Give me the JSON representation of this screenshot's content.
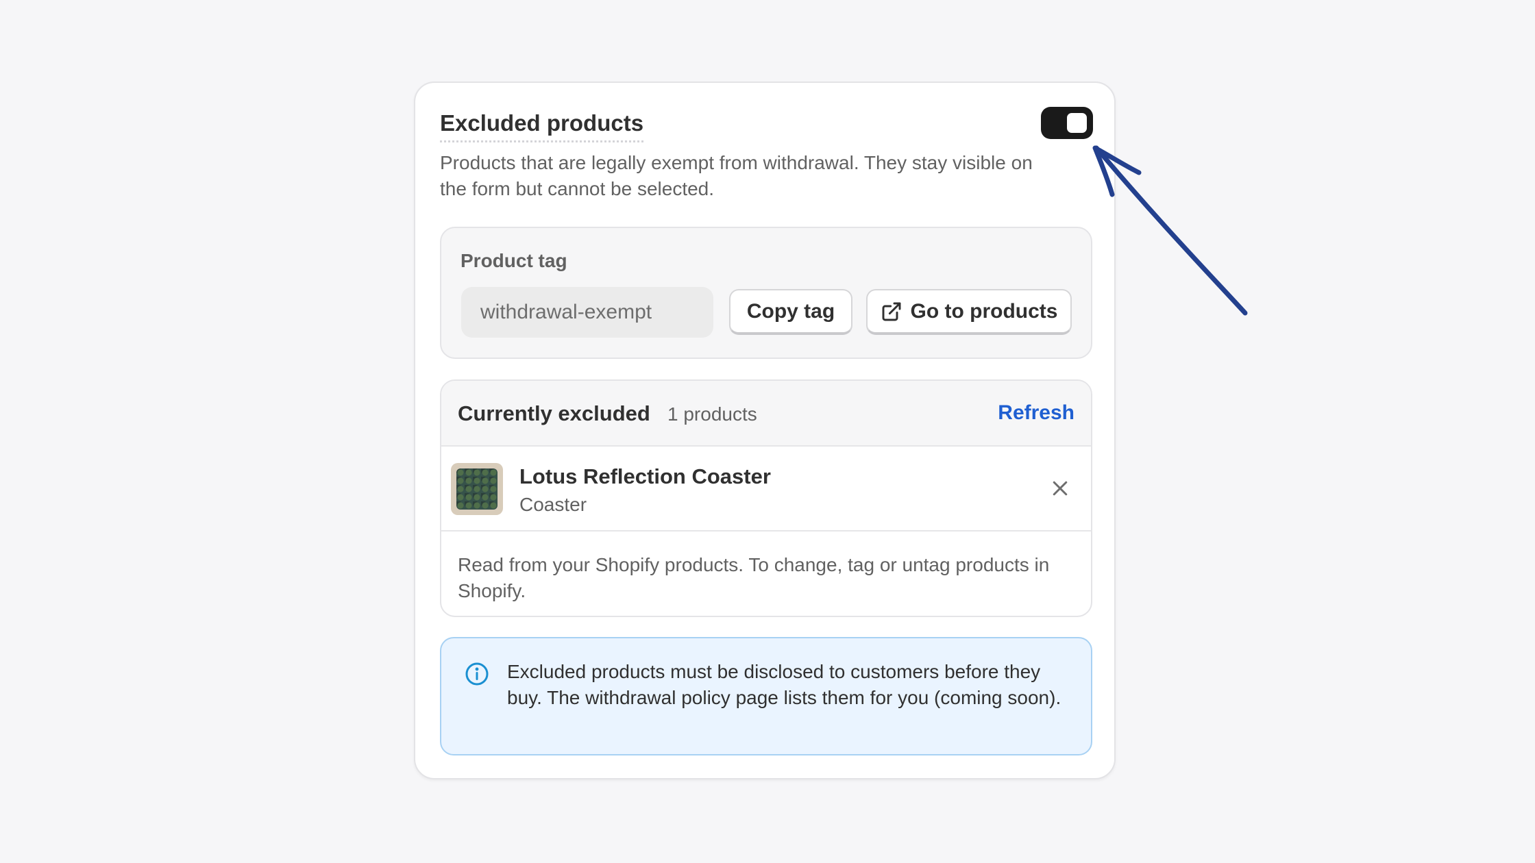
{
  "section": {
    "title": "Excluded products",
    "description": "Products that are legally exempt from withdrawal. They stay visible on the form but cannot be selected.",
    "toggle_on": true
  },
  "product_tag": {
    "label": "Product tag",
    "value": "withdrawal-exempt",
    "copy_button": "Copy tag",
    "go_button": "Go to products",
    "go_icon": "external-link-icon"
  },
  "excluded": {
    "title": "Currently excluded",
    "count": "1 products",
    "refresh": "Refresh",
    "items": [
      {
        "name": "Lotus Reflection Coaster",
        "type": "Coaster"
      }
    ],
    "note": "Read from your Shopify products. To change, tag or untag products in Shopify."
  },
  "banner": {
    "icon": "info-icon",
    "text": "Excluded products must be disclosed to customers before they buy. The withdrawal policy page lists them for you (coming soon)."
  },
  "colors": {
    "accent": "#1f5fd1",
    "toggle": "#1a1a1a",
    "info": "#1a8fd1",
    "annotation_arrow": "#23408e"
  }
}
